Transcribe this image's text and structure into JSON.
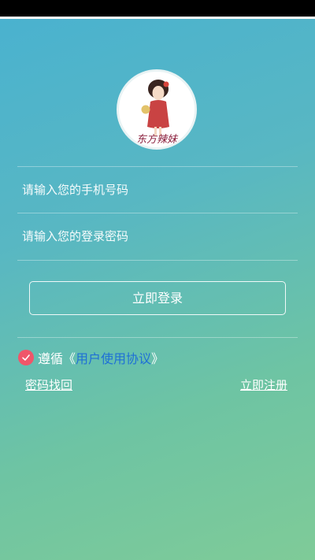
{
  "login": {
    "phone_placeholder": "请输入您的手机号码",
    "password_placeholder": "请输入您的登录密码",
    "login_button": "立即登录",
    "agree_prefix": "遵循《",
    "agree_link": "用户使用协议",
    "agree_suffix": "》",
    "forgot_password": "密码找回",
    "register": "立即注册"
  },
  "logo": {
    "text": "东方辣妹"
  },
  "colors": {
    "accent_link": "#1e6fd6",
    "check": "#f0566a",
    "bg_top": "#4ab2cf",
    "bg_bottom": "#7fcb98"
  }
}
